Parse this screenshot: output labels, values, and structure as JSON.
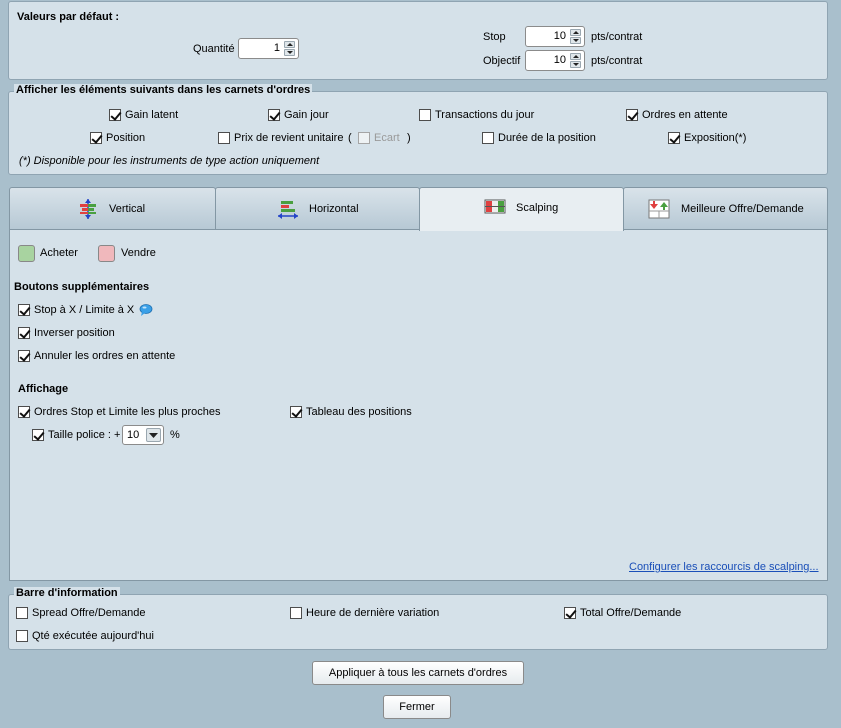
{
  "defaults": {
    "title": "Valeurs par défaut :",
    "quantity_label": "Quantité",
    "quantity_value": "1",
    "stop_label": "Stop",
    "stop_value": "10",
    "stop_unit": "pts/contrat",
    "target_label": "Objectif",
    "target_value": "10",
    "target_unit": "pts/contrat"
  },
  "display": {
    "title": "Afficher les éléments suivants dans les carnets d'ordres",
    "items": [
      {
        "label": "Gain latent",
        "checked": true
      },
      {
        "label": "Gain jour",
        "checked": true
      },
      {
        "label": "Transactions du jour",
        "checked": false
      },
      {
        "label": "Ordres en attente",
        "checked": true
      },
      {
        "label": "Position",
        "checked": true
      },
      {
        "label": "Prix de revient unitaire",
        "checked": false
      },
      {
        "label": "Ecart",
        "checked": false
      },
      {
        "label": "Durée de la position",
        "checked": false
      },
      {
        "label": "Exposition(*)",
        "checked": true
      }
    ],
    "paren_open": "(",
    "paren_close": ")",
    "footnote": "(*) Disponible pour les instruments de type action uniquement"
  },
  "tabs": [
    {
      "label": "Vertical",
      "icon": "vertical-ladder-icon",
      "active": false
    },
    {
      "label": "Horizontal",
      "icon": "horizontal-ladder-icon",
      "active": false
    },
    {
      "label": "Scalping",
      "icon": "scalping-grid-icon",
      "active": true
    },
    {
      "label": "Meilleure Offre/Demande",
      "icon": "best-bid-ask-icon",
      "active": false
    }
  ],
  "scalping": {
    "buy_label": "Acheter",
    "buy_color": "#a8d3a0",
    "sell_label": "Vendre",
    "sell_color": "#f0b8bc",
    "extra_buttons_title": "Boutons supplémentaires",
    "extra_buttons": [
      {
        "label": "Stop à X / Limite à X",
        "checked": true
      },
      {
        "label": "Inverser position",
        "checked": true
      },
      {
        "label": "Annuler les ordres en attente",
        "checked": true
      }
    ],
    "display_title": "Affichage",
    "display_items": [
      {
        "label": "Ordres Stop et Limite les plus proches",
        "checked": true
      },
      {
        "label": "Tableau des positions",
        "checked": true
      },
      {
        "label": "Taille police : +",
        "checked": true
      }
    ],
    "font_size_value": "10",
    "font_size_unit": "%",
    "shortcuts_link": "Configurer les raccourcis de scalping..."
  },
  "info_bar": {
    "title": "Barre d'information",
    "items": [
      {
        "label": "Spread Offre/Demande",
        "checked": false
      },
      {
        "label": "Heure de dernière variation",
        "checked": false
      },
      {
        "label": "Total Offre/Demande",
        "checked": true
      },
      {
        "label": "Qté exécutée aujourd'hui",
        "checked": false
      }
    ]
  },
  "buttons": {
    "apply_all": "Appliquer à tous les carnets d'ordres",
    "close": "Fermer"
  }
}
